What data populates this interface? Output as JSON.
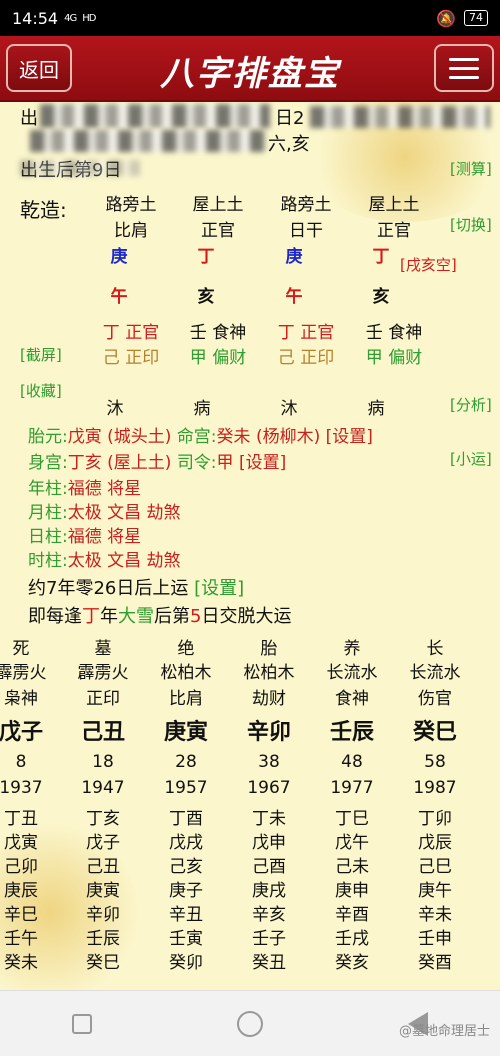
{
  "status": {
    "time": "14:54",
    "signal": "4G",
    "net": "HD",
    "battery": "74"
  },
  "header": {
    "back": "返回",
    "title": "八字排盘宝"
  },
  "top": {
    "row1_left": "出",
    "row1_mid": "日2",
    "row2_mid": "六,亥",
    "row3": "出生后第9日",
    "row3_fade": "[…]",
    "measure": "[测算]"
  },
  "chart": {
    "label": "乾造:",
    "switch": "[切换]",
    "nayin": [
      "路旁土",
      "屋上土",
      "路旁土",
      "屋上土"
    ],
    "shishen": [
      "比肩",
      "正官",
      "日干",
      "正官"
    ],
    "gan": [
      "庚",
      "丁",
      "庚",
      "丁"
    ],
    "kongwang": "[戌亥空]",
    "zhi": [
      "午",
      "亥",
      "午",
      "亥"
    ],
    "hidden1": [
      "丁 正官",
      "壬 食神",
      "丁 正官",
      "壬 食神"
    ],
    "hidden2": [
      "己 正印",
      "甲 偏财",
      "己 正印",
      "甲 偏财"
    ],
    "screenshot": "[截屏]",
    "collect": "[收藏]",
    "changsheng": [
      "沐",
      "病",
      "沐",
      "病"
    ],
    "analysis": "[分析]"
  },
  "info": {
    "taiyuan_label": "胎元:",
    "taiyuan": "戊寅 (城头土)",
    "minggong_label": "命宫:",
    "minggong": "癸未 (杨柳木)",
    "set1": "[设置]",
    "shengong_label": "身宫:",
    "shengong": "丁亥 (屋上土)",
    "siling_label": "司令:",
    "siling": "甲",
    "set2": "[设置]",
    "xiaoyun": "[小运]",
    "nianzhu_label": "年柱:",
    "nianzhu": "福德 将星",
    "yuezhu_label": "月柱:",
    "yuezhu": "太极 文昌 劫煞",
    "rizhu_label": "日柱:",
    "rizhu": "福德 将星",
    "shizhu_label": "时柱:",
    "shizhu": "太极 文昌 劫煞",
    "qiyun": "约7年零26日后上运",
    "set3": "[设置]",
    "jiaoyun_pre": "即每逢",
    "jiaoyun_gan": "丁",
    "jiaoyun_mid": "年",
    "jiaoyun_term": "大雪",
    "jiaoyun_post1": "后第",
    "jiaoyun_num": "5",
    "jiaoyun_post2": "日交脱大运"
  },
  "dayun": {
    "changsheng": [
      "死",
      "墓",
      "绝",
      "胎",
      "养",
      "长"
    ],
    "nayin": [
      "霹雳火",
      "霹雳火",
      "松柏木",
      "松柏木",
      "长流水",
      "长流水"
    ],
    "shishen": [
      "枭神",
      "正印",
      "比肩",
      "劫财",
      "食神",
      "伤官"
    ],
    "ganzhi": [
      "戊子",
      "己丑",
      "庚寅",
      "辛卯",
      "壬辰",
      "癸巳"
    ],
    "age": [
      "8",
      "18",
      "28",
      "38",
      "48",
      "58"
    ],
    "year": [
      "1937",
      "1947",
      "1957",
      "1967",
      "1977",
      "1987"
    ],
    "rows": [
      [
        "丁丑",
        "丁亥",
        "丁酉",
        "丁未",
        "丁巳",
        "丁卯"
      ],
      [
        "戊寅",
        "戊子",
        "戊戌",
        "戊申",
        "戊午",
        "戊辰"
      ],
      [
        "己卯",
        "己丑",
        "己亥",
        "己酉",
        "己未",
        "己巳"
      ],
      [
        "庚辰",
        "庚寅",
        "庚子",
        "庚戌",
        "庚申",
        "庚午"
      ],
      [
        "辛巳",
        "辛卯",
        "辛丑",
        "辛亥",
        "辛酉",
        "辛未"
      ],
      [
        "壬午",
        "壬辰",
        "壬寅",
        "壬子",
        "壬戌",
        "壬申"
      ],
      [
        "癸未",
        "癸巳",
        "癸卯",
        "癸丑",
        "癸亥",
        "癸酉"
      ]
    ]
  },
  "watermark": "@墓地命理居士"
}
